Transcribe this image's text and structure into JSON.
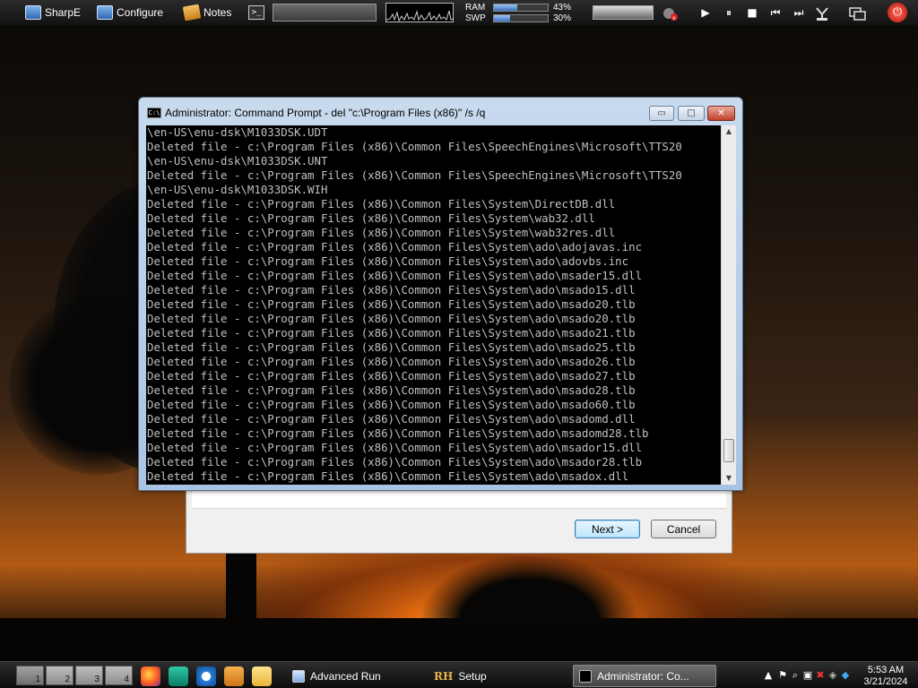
{
  "topbar": {
    "launchers": [
      {
        "label": "SharpE",
        "icon": "monitor-icon"
      },
      {
        "label": "Configure",
        "icon": "monitor-icon"
      },
      {
        "label": "Notes",
        "icon": "notes-icon"
      }
    ],
    "terminal_glyph": ">_",
    "memory": {
      "ram_label": "RAM",
      "ram_percent": "43%",
      "ram_fraction": 0.43,
      "swp_label": "SWP",
      "swp_percent": "30%",
      "swp_fraction": 0.3
    },
    "media": {
      "play": "▶",
      "pause": "⏸",
      "stop": "■",
      "prev": "⏮",
      "next": "⏭"
    },
    "power_glyph": "⏻"
  },
  "cmd_window": {
    "title": "Administrator:  Command Prompt - del  \"c:\\Program Files (x86)\" /s /q",
    "buttons": {
      "minimize": "▭",
      "maximize": "□",
      "close": "✕"
    },
    "lines": [
      "\\en-US\\enu-dsk\\M1033DSK.UDT",
      "Deleted file - c:\\Program Files (x86)\\Common Files\\SpeechEngines\\Microsoft\\TTS20",
      "\\en-US\\enu-dsk\\M1033DSK.UNT",
      "Deleted file - c:\\Program Files (x86)\\Common Files\\SpeechEngines\\Microsoft\\TTS20",
      "\\en-US\\enu-dsk\\M1033DSK.WIH",
      "Deleted file - c:\\Program Files (x86)\\Common Files\\System\\DirectDB.dll",
      "Deleted file - c:\\Program Files (x86)\\Common Files\\System\\wab32.dll",
      "Deleted file - c:\\Program Files (x86)\\Common Files\\System\\wab32res.dll",
      "Deleted file - c:\\Program Files (x86)\\Common Files\\System\\ado\\adojavas.inc",
      "Deleted file - c:\\Program Files (x86)\\Common Files\\System\\ado\\adovbs.inc",
      "Deleted file - c:\\Program Files (x86)\\Common Files\\System\\ado\\msader15.dll",
      "Deleted file - c:\\Program Files (x86)\\Common Files\\System\\ado\\msado15.dll",
      "Deleted file - c:\\Program Files (x86)\\Common Files\\System\\ado\\msado20.tlb",
      "Deleted file - c:\\Program Files (x86)\\Common Files\\System\\ado\\msado20.tlb",
      "Deleted file - c:\\Program Files (x86)\\Common Files\\System\\ado\\msado21.tlb",
      "Deleted file - c:\\Program Files (x86)\\Common Files\\System\\ado\\msado25.tlb",
      "Deleted file - c:\\Program Files (x86)\\Common Files\\System\\ado\\msado26.tlb",
      "Deleted file - c:\\Program Files (x86)\\Common Files\\System\\ado\\msado27.tlb",
      "Deleted file - c:\\Program Files (x86)\\Common Files\\System\\ado\\msado28.tlb",
      "Deleted file - c:\\Program Files (x86)\\Common Files\\System\\ado\\msado60.tlb",
      "Deleted file - c:\\Program Files (x86)\\Common Files\\System\\ado\\msadomd.dll",
      "Deleted file - c:\\Program Files (x86)\\Common Files\\System\\ado\\msadomd28.tlb",
      "Deleted file - c:\\Program Files (x86)\\Common Files\\System\\ado\\msador15.dll",
      "Deleted file - c:\\Program Files (x86)\\Common Files\\System\\ado\\msador28.tlb",
      "Deleted file - c:\\Program Files (x86)\\Common Files\\System\\ado\\msadox.dll"
    ]
  },
  "setup_dialog": {
    "next_label": "Next >",
    "cancel_label": "Cancel"
  },
  "taskbar": {
    "workspaces": [
      "1",
      "2",
      "3",
      "4"
    ],
    "tasks": [
      {
        "label": "Advanced Run",
        "icon": "advanced-run-icon",
        "active": false
      },
      {
        "label": "Setup",
        "icon": "rh-setup-icon",
        "icon_text": "RH",
        "active": false
      },
      {
        "label": "Administrator:  Co...",
        "icon": "command-prompt-icon",
        "active": true
      }
    ],
    "clock": {
      "time": "5:53 AM",
      "date": "3/21/2024"
    }
  },
  "colors": {
    "console_bg": "#000000",
    "console_text": "#c0c0c0",
    "accent": "#3c7fb1"
  }
}
